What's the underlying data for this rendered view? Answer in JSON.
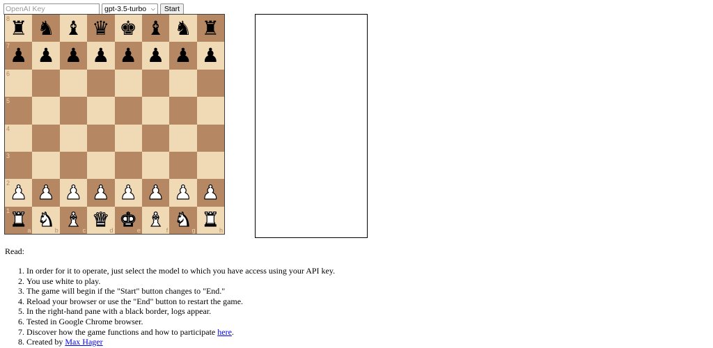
{
  "controls": {
    "api_key_placeholder": "OpenAI Key",
    "model_selected": "gpt-3.5-turbo",
    "start_label": "Start"
  },
  "board": {
    "light_color": "#f0d9b5",
    "dark_color": "#b58863",
    "ranks": [
      "8",
      "7",
      "6",
      "5",
      "4",
      "3",
      "2",
      "1"
    ],
    "files": [
      "a",
      "b",
      "c",
      "d",
      "e",
      "f",
      "g",
      "h"
    ],
    "position": [
      [
        "bR",
        "bN",
        "bB",
        "bQ",
        "bK",
        "bB",
        "bN",
        "bR"
      ],
      [
        "bP",
        "bP",
        "bP",
        "bP",
        "bP",
        "bP",
        "bP",
        "bP"
      ],
      [
        "",
        "",
        "",
        "",
        "",
        "",
        "",
        ""
      ],
      [
        "",
        "",
        "",
        "",
        "",
        "",
        "",
        ""
      ],
      [
        "",
        "",
        "",
        "",
        "",
        "",
        "",
        ""
      ],
      [
        "",
        "",
        "",
        "",
        "",
        "",
        "",
        ""
      ],
      [
        "wP",
        "wP",
        "wP",
        "wP",
        "wP",
        "wP",
        "wP",
        "wP"
      ],
      [
        "wR",
        "wN",
        "wB",
        "wQ",
        "wK",
        "wB",
        "wN",
        "wR"
      ]
    ]
  },
  "log_pane": {
    "content": ""
  },
  "instructions": {
    "heading": "Read:",
    "items": [
      "In order for it to operate, just select the model to which you have access using your API key.",
      "You use white to play.",
      "The game will begin if the \"Start\" button changes to \"End.\"",
      "Reload your browser or use the \"End\" button to restart the game.",
      "In the right-hand pane with a black border, logs appear.",
      "Tested in Google Chrome browser."
    ],
    "item7_text": "Discover how the game functions and how to participate ",
    "item7_link": "here",
    "item7_suffix": ".",
    "item8_text": "Created by ",
    "item8_link": "Max Hager"
  }
}
